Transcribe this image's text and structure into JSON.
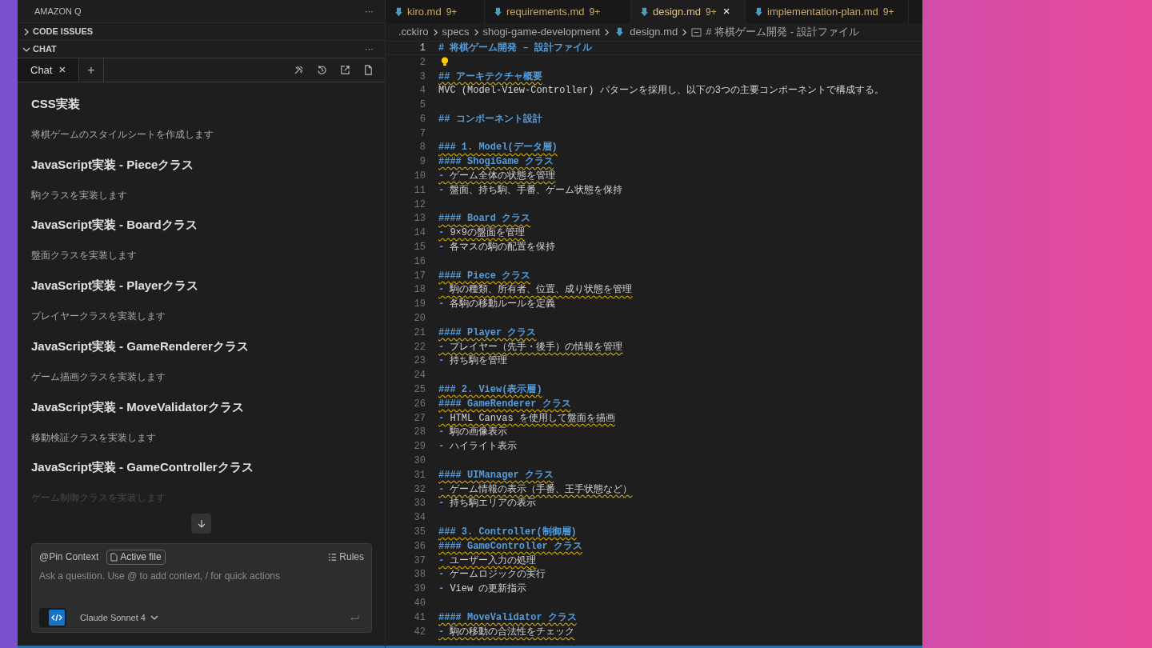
{
  "side_panel": {
    "title": "AMAZON Q",
    "more": "···",
    "sections": [
      {
        "label": "CODE ISSUES",
        "expanded": false
      },
      {
        "label": "CHAT",
        "expanded": true,
        "more": "···"
      }
    ],
    "chat_tabs": [
      {
        "label": "Chat",
        "close": "×",
        "selected": true
      }
    ],
    "new_tab": "+",
    "messages": [
      {
        "title": "CSS実装",
        "text": "将棋ゲームのスタイルシートを作成します",
        "faded": false
      },
      {
        "title": "JavaScript実装 - Pieceクラス",
        "text": "駒クラスを実装します",
        "faded": false
      },
      {
        "title": "JavaScript実装 - Boardクラス",
        "text": "盤面クラスを実装します",
        "faded": false
      },
      {
        "title": "JavaScript実装 - Playerクラス",
        "text": "プレイヤークラスを実装します",
        "faded": false
      },
      {
        "title": "JavaScript実装 - GameRendererクラス",
        "text": "ゲーム描画クラスを実装します",
        "faded": false
      },
      {
        "title": "JavaScript実装 - MoveValidatorクラス",
        "text": "移動検証クラスを実装します",
        "faded": false
      },
      {
        "title": "JavaScript実装 - GameControllerクラス",
        "text": "ゲーム制御クラスを実装します",
        "faded": true
      }
    ],
    "input": {
      "pin_context": "@Pin Context",
      "context_chip": "Active file",
      "rules": "Rules",
      "placeholder": "Ask a question. Use @ to add context, / for quick actions",
      "model": "Claude Sonnet 4"
    }
  },
  "editor": {
    "tabs": [
      {
        "label": "kiro.md",
        "badge": "9+",
        "selected": false
      },
      {
        "label": "requirements.md",
        "badge": "9+",
        "selected": false
      },
      {
        "label": "design.md",
        "badge": "9+",
        "selected": true,
        "close": "×"
      },
      {
        "label": "implementation-plan.md",
        "badge": "9+",
        "selected": false
      }
    ],
    "breadcrumb": [
      {
        "label": ".cckiro",
        "kind": "folder"
      },
      {
        "label": "specs",
        "kind": "folder"
      },
      {
        "label": "shogi-game-development",
        "kind": "folder"
      },
      {
        "label": "design.md",
        "kind": "file"
      },
      {
        "label": "# 将棋ゲーム開発 - 設計ファイル",
        "kind": "symbol"
      }
    ],
    "lines": [
      {
        "n": "1",
        "kind": "heading",
        "text": "# 将棋ゲーム開発 – 設計ファイル",
        "squiggle": false,
        "current": true
      },
      {
        "n": "2",
        "kind": "lightbulb"
      },
      {
        "n": "3",
        "kind": "heading",
        "text": "## アーキテクチャ概要",
        "squiggle": true
      },
      {
        "n": "4",
        "kind": "plain",
        "text": "MVC (Model-View-Controller) パターンを採用し、以下の3つの主要コンポーネントで構成する。",
        "squiggle": false
      },
      {
        "n": "5",
        "kind": "empty"
      },
      {
        "n": "6",
        "kind": "heading",
        "text": "## コンポーネント設計",
        "squiggle": false
      },
      {
        "n": "7",
        "kind": "empty"
      },
      {
        "n": "8",
        "kind": "heading",
        "text": "### 1. Model(データ層)",
        "squiggle": true
      },
      {
        "n": "9",
        "kind": "heading",
        "text": "#### ShogiGame クラス",
        "squiggle": true
      },
      {
        "n": "10",
        "kind": "bullet",
        "marker": "-",
        "text": "ゲーム全体の状態を管理",
        "squiggle": true
      },
      {
        "n": "11",
        "kind": "bullet",
        "marker": "-",
        "text": "盤面、持ち駒、手番、ゲーム状態を保持",
        "squiggle": false
      },
      {
        "n": "12",
        "kind": "empty"
      },
      {
        "n": "13",
        "kind": "heading",
        "text": "#### Board クラス",
        "squiggle": true
      },
      {
        "n": "14",
        "kind": "bullet",
        "marker": "-",
        "text": "9×9の盤面を管理",
        "squiggle": true
      },
      {
        "n": "15",
        "kind": "bullet",
        "marker": "-",
        "text": "各マスの駒の配置を保持",
        "squiggle": false
      },
      {
        "n": "16",
        "kind": "empty"
      },
      {
        "n": "17",
        "kind": "heading",
        "text": "#### Piece クラス",
        "squiggle": true
      },
      {
        "n": "18",
        "kind": "bullet",
        "marker": "-",
        "text": "駒の種類、所有者、位置、成り状態を管理",
        "squiggle": true
      },
      {
        "n": "19",
        "kind": "bullet",
        "marker": "-",
        "text": "各駒の移動ルールを定義",
        "squiggle": false
      },
      {
        "n": "20",
        "kind": "empty"
      },
      {
        "n": "21",
        "kind": "heading",
        "text": "#### Player クラス",
        "squiggle": true
      },
      {
        "n": "22",
        "kind": "bullet",
        "marker": "-",
        "text": "プレイヤー（先手・後手）の情報を管理",
        "squiggle": true
      },
      {
        "n": "23",
        "kind": "bullet",
        "marker": "-",
        "text": "持ち駒を管理",
        "squiggle": false
      },
      {
        "n": "24",
        "kind": "empty"
      },
      {
        "n": "25",
        "kind": "heading",
        "text": "### 2. View(表示層)",
        "squiggle": true
      },
      {
        "n": "26",
        "kind": "heading",
        "text": "#### GameRenderer クラス",
        "squiggle": true
      },
      {
        "n": "27",
        "kind": "bullet",
        "marker": "-",
        "text": "HTML Canvas を使用して盤面を描画",
        "squiggle": true
      },
      {
        "n": "28",
        "kind": "bullet",
        "marker": "-",
        "text": "駒の画像表示",
        "squiggle": false
      },
      {
        "n": "29",
        "kind": "bullet",
        "marker": "-",
        "text": "ハイライト表示",
        "squiggle": false
      },
      {
        "n": "30",
        "kind": "empty"
      },
      {
        "n": "31",
        "kind": "heading",
        "text": "#### UIManager クラス",
        "squiggle": true
      },
      {
        "n": "32",
        "kind": "bullet",
        "marker": "-",
        "text": "ゲーム情報の表示（手番、王手状態など）",
        "squiggle": true
      },
      {
        "n": "33",
        "kind": "bullet",
        "marker": "-",
        "text": "持ち駒エリアの表示",
        "squiggle": false
      },
      {
        "n": "34",
        "kind": "empty"
      },
      {
        "n": "35",
        "kind": "heading",
        "text": "### 3. Controller(制御層)",
        "squiggle": true
      },
      {
        "n": "36",
        "kind": "heading",
        "text": "#### GameController クラス",
        "squiggle": true
      },
      {
        "n": "37",
        "kind": "bullet",
        "marker": "-",
        "text": "ユーザー入力の処理",
        "squiggle": true
      },
      {
        "n": "38",
        "kind": "bullet",
        "marker": "-",
        "text": "ゲームロジックの実行",
        "squiggle": false
      },
      {
        "n": "39",
        "kind": "bullet",
        "marker": "-",
        "text": "View の更新指示",
        "squiggle": false
      },
      {
        "n": "40",
        "kind": "empty"
      },
      {
        "n": "41",
        "kind": "heading",
        "text": "#### MoveValidator クラス",
        "squiggle": true
      },
      {
        "n": "42",
        "kind": "bullet",
        "marker": "-",
        "text": "駒の移動の合法性をチェック",
        "squiggle": true
      }
    ]
  }
}
